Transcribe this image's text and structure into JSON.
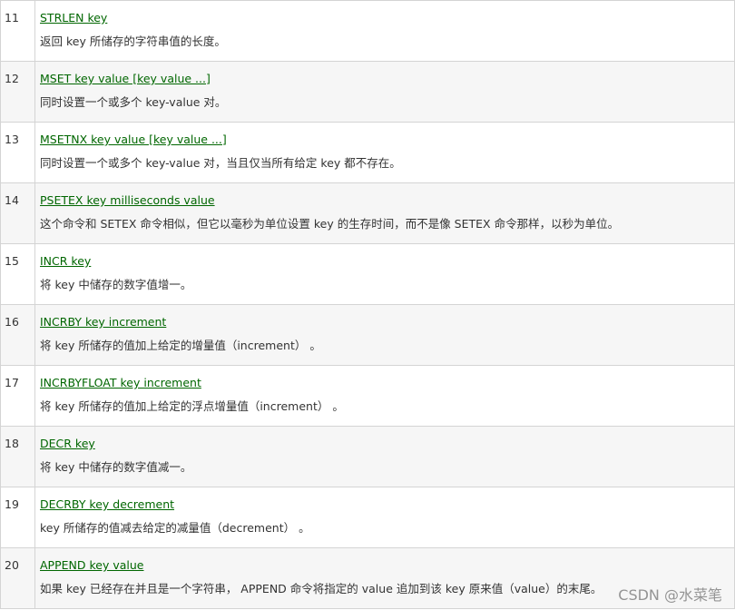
{
  "rows": [
    {
      "num": "11",
      "cmd": "STRLEN key",
      "desc": "返回 key 所储存的字符串值的长度。"
    },
    {
      "num": "12",
      "cmd": "MSET key value [key value ...]",
      "desc": "同时设置一个或多个 key-value 对。"
    },
    {
      "num": "13",
      "cmd": "MSETNX key value [key value ...]",
      "desc": "同时设置一个或多个 key-value 对，当且仅当所有给定 key 都不存在。"
    },
    {
      "num": "14",
      "cmd": "PSETEX key milliseconds value",
      "desc": "这个命令和 SETEX 命令相似，但它以毫秒为单位设置 key 的生存时间，而不是像 SETEX 命令那样，以秒为单位。"
    },
    {
      "num": "15",
      "cmd": "INCR key",
      "desc": "将 key 中储存的数字值增一。"
    },
    {
      "num": "16",
      "cmd": "INCRBY key increment",
      "desc": "将 key 所储存的值加上给定的增量值（increment） 。"
    },
    {
      "num": "17",
      "cmd": "INCRBYFLOAT key increment",
      "desc": "将 key 所储存的值加上给定的浮点增量值（increment） 。"
    },
    {
      "num": "18",
      "cmd": "DECR key",
      "desc": "将 key 中储存的数字值减一。"
    },
    {
      "num": "19",
      "cmd": "DECRBY key decrement",
      "desc": "key 所储存的值减去给定的减量值（decrement） 。"
    },
    {
      "num": "20",
      "cmd": "APPEND key value",
      "desc": "如果 key 已经存在并且是一个字符串， APPEND 命令将指定的 value 追加到该 key 原来值（value）的末尾。"
    }
  ],
  "watermark": "CSDN @水菜笔",
  "colors": {
    "link": "#006600",
    "alt_row": "#f6f6f6",
    "border": "#d4d4d4"
  }
}
